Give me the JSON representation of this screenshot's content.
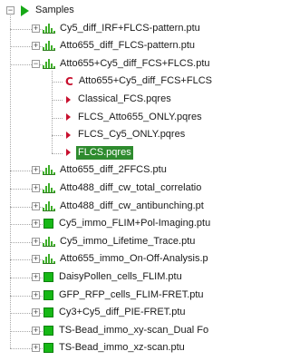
{
  "colors": {
    "accent_green": "#2e8b2e",
    "icon_green": "#16b816",
    "icon_red": "#c8102e"
  },
  "tree": {
    "root": {
      "label": "Samples",
      "icon": "green-play-icon",
      "expanded": true
    },
    "items": [
      {
        "label": "Cy5_diff_IRF+FLCS-pattern.ptu",
        "icon": "bars-icon",
        "expander": "+"
      },
      {
        "label": "Atto655_diff_FLCS-pattern.ptu",
        "icon": "bars-icon",
        "expander": "+"
      },
      {
        "label": "Atto655+Cy5_diff_FCS+FLCS.ptu",
        "icon": "bars-icon",
        "expander": "-"
      },
      {
        "label": "Atto655+Cy5_diff_FCS+FLCS",
        "icon": "c-icon",
        "child": true
      },
      {
        "label": "Classical_FCS.pqres",
        "icon": "red-arrow-icon",
        "child": true
      },
      {
        "label": "FLCS_Atto655_ONLY.pqres",
        "icon": "red-arrow-icon",
        "child": true
      },
      {
        "label": "FLCS_Cy5_ONLY.pqres",
        "icon": "red-arrow-icon",
        "child": true
      },
      {
        "label": "FLCS.pqres",
        "icon": "red-arrow-icon",
        "child": true,
        "selected": true
      },
      {
        "label": "Atto655_diff_2FFCS.ptu",
        "icon": "bars-icon",
        "expander": "+"
      },
      {
        "label": "Atto488_diff_cw_total_correlatio",
        "icon": "bars-icon",
        "expander": "+"
      },
      {
        "label": "Atto488_diff_cw_antibunching.pt",
        "icon": "bars-icon",
        "expander": "+"
      },
      {
        "label": "Cy5_immo_FLIM+Pol-Imaging.ptu",
        "icon": "square-icon",
        "expander": "+"
      },
      {
        "label": "Cy5_immo_Lifetime_Trace.ptu",
        "icon": "bars-icon",
        "expander": "+"
      },
      {
        "label": "Atto655_immo_On-Off-Analysis.p",
        "icon": "bars-icon",
        "expander": "+"
      },
      {
        "label": "DaisyPollen_cells_FLIM.ptu",
        "icon": "square-icon",
        "expander": "+"
      },
      {
        "label": "GFP_RFP_cells_FLIM-FRET.ptu",
        "icon": "square-icon",
        "expander": "+"
      },
      {
        "label": "Cy3+Cy5_diff_PIE-FRET.ptu",
        "icon": "square-icon",
        "expander": "+"
      },
      {
        "label": "TS-Bead_immo_xy-scan_Dual Fo",
        "icon": "square-icon",
        "expander": "+"
      },
      {
        "label": "TS-Bead_immo_xz-scan.ptu",
        "icon": "square-icon",
        "expander": "+"
      }
    ]
  }
}
